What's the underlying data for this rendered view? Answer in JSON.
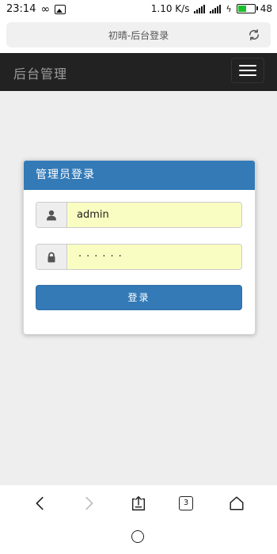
{
  "status_bar": {
    "time": "23:14",
    "network_speed": "1.10 K/s",
    "battery_level": "48"
  },
  "browser": {
    "page_title": "初晴-后台登录",
    "tabs_count": "3"
  },
  "navbar": {
    "brand": "后台管理"
  },
  "login_panel": {
    "heading": "管理员登录",
    "username_value": "admin",
    "password_mask": "······",
    "submit_label": "登录"
  },
  "colors": {
    "navbar_bg": "#222222",
    "primary": "#337ab7",
    "autofill_bg": "#fafdc1",
    "content_bg": "#eeeeee"
  },
  "icons": [
    "infinity-icon",
    "photo-icon",
    "signal-icon",
    "charging-icon",
    "battery-icon",
    "refresh-icon",
    "menu-icon",
    "user-icon",
    "lock-icon",
    "back-icon",
    "forward-icon",
    "share-icon",
    "tabs-icon",
    "home-icon"
  ]
}
